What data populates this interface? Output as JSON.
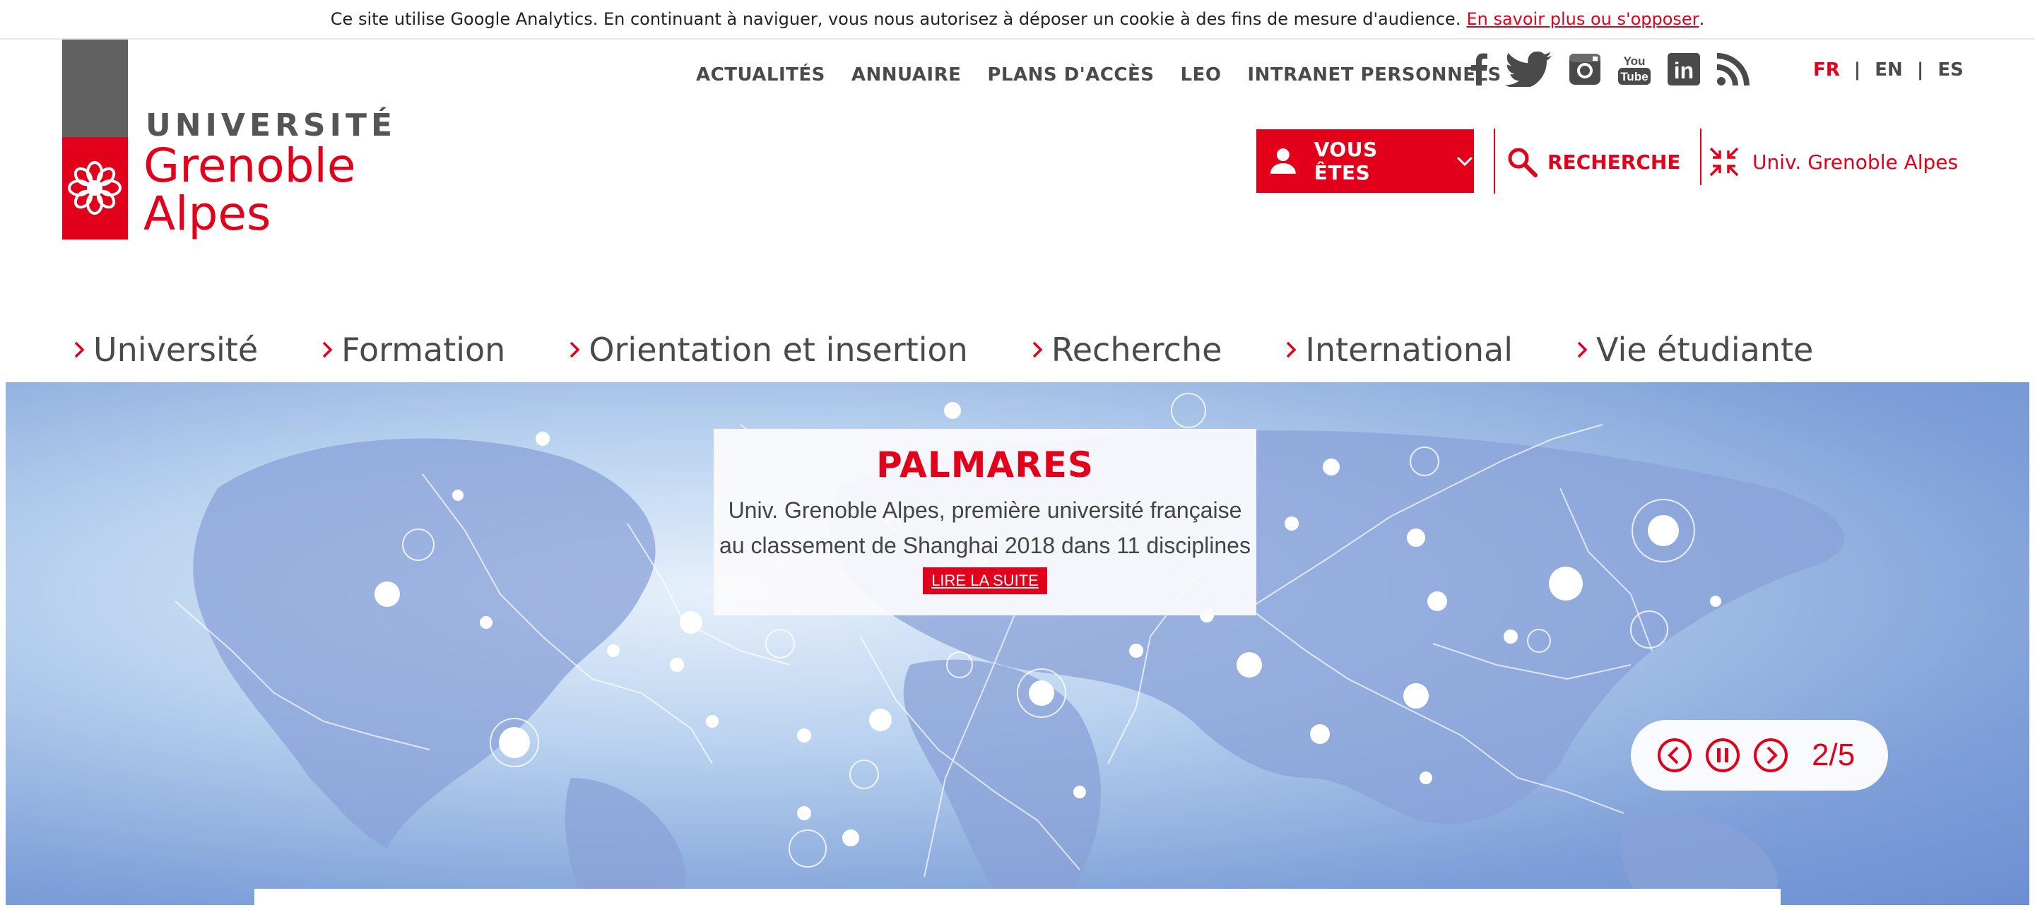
{
  "cookie_bar": {
    "text": "Ce site utilise Google Analytics. En continuant à naviguer, vous nous autorisez à déposer un cookie à des fins de mesure d'audience.",
    "link_text": "En savoir plus ou s'opposer",
    "suffix": "."
  },
  "logo": {
    "line1": "UNIVERSITÉ",
    "line2": "Grenoble",
    "line3": "Alpes"
  },
  "top_nav": {
    "items": [
      {
        "label": "ACTUALITÉS"
      },
      {
        "label": "ANNUAIRE"
      },
      {
        "label": "PLANS D'ACCÈS"
      },
      {
        "label": "LEO"
      },
      {
        "label": "INTRANET PERSONNELS"
      }
    ]
  },
  "social": {
    "icons": [
      "facebook-icon",
      "twitter-icon",
      "instagram-icon",
      "youtube-icon",
      "linkedin-icon",
      "rss-icon"
    ],
    "youtube_text_1": "You",
    "youtube_text_2": "Tube",
    "linkedin_text": "in"
  },
  "languages": {
    "items": [
      {
        "label": "FR",
        "active": true
      },
      {
        "label": "EN",
        "active": false
      },
      {
        "label": "ES",
        "active": false
      }
    ],
    "separator": "|"
  },
  "actions": {
    "vous_etes": "VOUS ÊTES",
    "recherche": "RECHERCHE",
    "univ_link": "Univ. Grenoble Alpes"
  },
  "main_nav": {
    "items": [
      {
        "label": "Université"
      },
      {
        "label": "Formation"
      },
      {
        "label": "Orientation et insertion"
      },
      {
        "label": "Recherche"
      },
      {
        "label": "International"
      },
      {
        "label": "Vie étudiante"
      }
    ]
  },
  "hero": {
    "title": "PALMARES",
    "text_line1": "Univ. Grenoble Alpes, première université française",
    "text_line2": "au classement de Shanghai 2018 dans 11 disciplines",
    "button": "LIRE LA SUITE"
  },
  "carousel": {
    "counter": "2/5"
  },
  "colors": {
    "brand_red": "#e2001a",
    "text_grey": "#4a4a4a",
    "logo_grey": "#606060"
  }
}
